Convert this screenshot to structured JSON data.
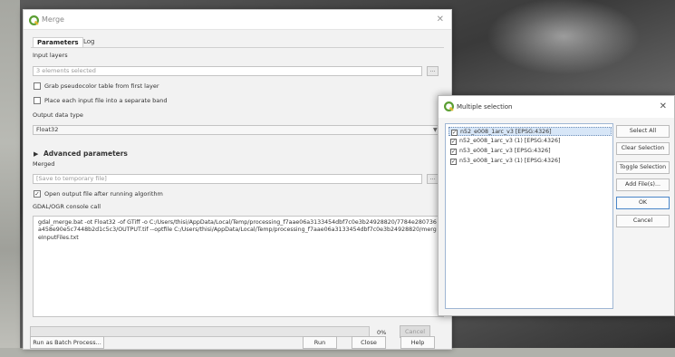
{
  "merge_dialog": {
    "title": "Merge",
    "tabs": [
      {
        "label": "Parameters"
      },
      {
        "label": "Log"
      }
    ],
    "input_layers_label": "Input layers",
    "input_layers_value": "3 elements selected",
    "grab_pseudocolor_label": "Grab pseudocolor table from first layer",
    "separate_band_label": "Place each input file into a separate band",
    "output_data_type_label": "Output data type",
    "output_data_type_value": "Float32",
    "advanced_parameters_label": "Advanced parameters",
    "merged_label": "Merged",
    "merged_placeholder": "[Save to temporary file]",
    "open_output_label": "Open output file after running algorithm",
    "console_label": "GDAL/OGR console call",
    "console_text": "gdal_merge.bat -ot Float32 -of GTiff -o C:/Users/thisi/AppData/Local/Temp/processing_f7aae06a3133454dbf7c0e3b24928820/7784e280736a458e90e5c7448b2d1c5c3/OUTPUT.tif --optfile C:/Users/thisi/AppData/Local/Temp/processing_f7aae06a3133454dbf7c0e3b24928820/mergeInputFiles.txt",
    "progress_percent": "0%",
    "cancel_label": "Cancel",
    "batch_label": "Run as Batch Process...",
    "run_label": "Run",
    "close_label": "Close",
    "help_label": "Help",
    "ellipsis": "..."
  },
  "multi_select": {
    "title": "Multiple selection",
    "items": [
      {
        "label": "n52_e008_1arc_v3 [EPSG:4326]",
        "checked": true
      },
      {
        "label": "n52_e008_1arc_v3 (1) [EPSG:4326]",
        "checked": true
      },
      {
        "label": "n53_e008_1arc_v3 [EPSG:4326]",
        "checked": true
      },
      {
        "label": "n53_e008_1arc_v3 (1) [EPSG:4326]",
        "checked": true
      }
    ],
    "buttons": {
      "select_all": "Select All",
      "clear_selection": "Clear Selection",
      "toggle_selection": "Toggle Selection",
      "add_files": "Add File(s)...",
      "ok": "OK",
      "cancel": "Cancel"
    }
  },
  "colors": {
    "qgis_green": "#5a9e32",
    "selection_blue": "#d7e6f7"
  },
  "icons": {
    "title": "qgis-icon",
    "check": "✓",
    "close": "✕"
  }
}
